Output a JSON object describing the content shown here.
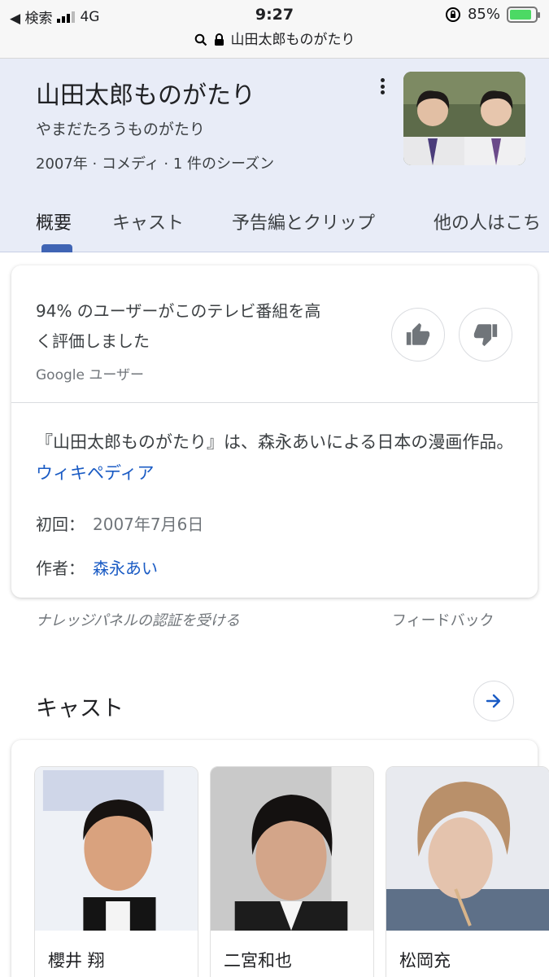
{
  "status_bar": {
    "back_label": "◀ 検索",
    "network": "4G",
    "time": "9:27",
    "battery": "85%",
    "battery_level": 0.85
  },
  "url_bar": {
    "domain": "山田太郎ものがたり"
  },
  "header": {
    "title": "山田太郎ものがたり",
    "reading": "やまだたろうものがたり",
    "meta": "2007年 · コメディ · 1 件のシーズン",
    "tabs": [
      "概要",
      "キャスト",
      "予告編とクリップ",
      "他の人はこち"
    ]
  },
  "rating_card": {
    "rating_text": "94% のユーザーがこのテレビ番組を高く評価しました",
    "source": "Google ユーザー",
    "description": "『山田太郎ものがたり』は、森永あいによる日本の漫画作品。",
    "description_link": "ウィキペディア",
    "facts": [
      {
        "label": "初回：",
        "value": "2007年7月6日"
      },
      {
        "label": "作者：",
        "value": "森永あい"
      }
    ]
  },
  "footer_links": {
    "claim": "ナレッジパネルの認証を受ける",
    "feedback": "フィードバック"
  },
  "cast": {
    "title": "キャスト",
    "members": [
      "櫻井 翔",
      "二宮和也",
      "松岡充"
    ]
  },
  "colors": {
    "accent": "#3f64b4",
    "link": "#1a5bc4",
    "header_bg": "#e8ecf7"
  }
}
